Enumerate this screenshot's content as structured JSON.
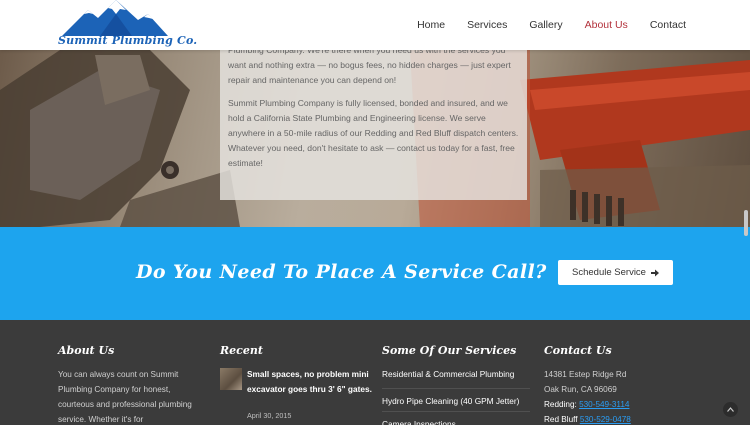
{
  "header": {
    "logo_text": "Summit Plumbing Co.",
    "nav": [
      {
        "label": "Home",
        "active": false
      },
      {
        "label": "Services",
        "active": false
      },
      {
        "label": "Gallery",
        "active": false
      },
      {
        "label": "About Us",
        "active": true
      },
      {
        "label": "Contact",
        "active": false
      }
    ]
  },
  "hero": {
    "paragraph1": "Plumbing Company. We're there when you need us with the services you want and nothing extra — no bogus fees, no hidden charges — just expert repair and maintenance you can depend on!",
    "paragraph2": "Summit Plumbing Company is fully licensed, bonded and insured, and we hold a California State Plumbing and Engineering license. We serve anywhere in a 50-mile radius of our Redding and Red Bluff dispatch centers. Whatever you need, don't hesitate to ask — contact us today for a fast, free estimate!"
  },
  "cta": {
    "title": "Do You Need To Place A Service Call?",
    "button_label": "Schedule Service"
  },
  "footer": {
    "about": {
      "title": "About Us",
      "text": "You can always count on Summit Plumbing Company for honest, courteous and professional plumbing service. Whether it's for"
    },
    "recent": {
      "title": "Recent",
      "post_title": "Small spaces, no problem mini excavator goes thru 3' 6\" gates.",
      "post_date": "April 30, 2015"
    },
    "services": {
      "title": "Some Of Our Services",
      "items": [
        "Residential & Commercial Plumbing",
        "Hydro Pipe Cleaning (40 GPM Jetter)",
        "Camera Inspections"
      ]
    },
    "contact": {
      "title": "Contact Us",
      "address1": "14381 Estep Ridge Rd",
      "address2": "Oak Run, CA 96069",
      "redding_label": "Redding:",
      "redding_phone": "530-549-3114",
      "redbluff_label": "Red Bluff",
      "redbluff_phone": "530-529-0478"
    }
  },
  "colors": {
    "accent_blue": "#1da4ee",
    "nav_active": "#b3323c",
    "footer_bg": "#3b3b3b",
    "logo_blue": "#1c63b7"
  }
}
